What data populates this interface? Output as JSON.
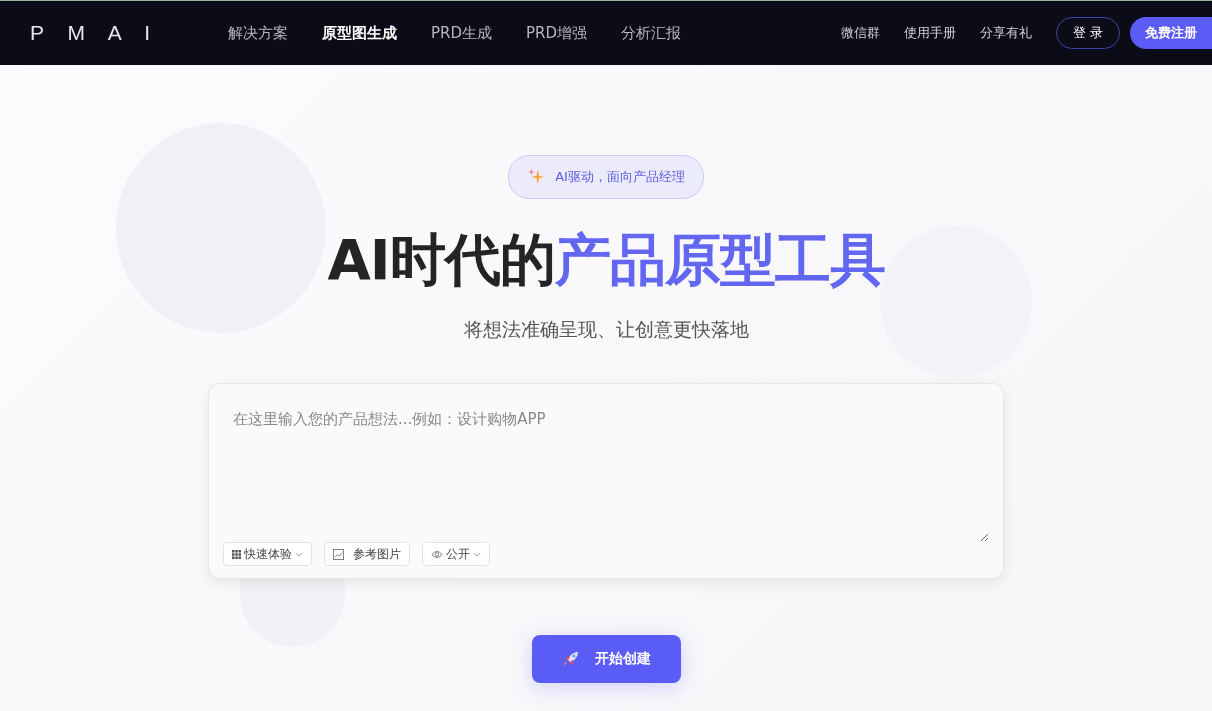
{
  "header": {
    "logo": "P M A I",
    "nav": [
      {
        "label": "解决方案",
        "selected": false
      },
      {
        "label": "原型图生成",
        "selected": true
      },
      {
        "label": "PRD生成",
        "selected": false
      },
      {
        "label": "PRD增强",
        "selected": false
      },
      {
        "label": "分析汇报",
        "selected": false
      }
    ],
    "links": [
      "微信群",
      "使用手册",
      "分享有礼"
    ],
    "login": "登 录",
    "register": "免费注册"
  },
  "hero": {
    "badge": "AI驱动，面向产品经理",
    "title_plain": "AI时代的",
    "title_accent": "产品原型工具",
    "subtitle": "将想法准确呈现、让创意更快落地"
  },
  "prompt": {
    "placeholder": "在这里输入您的产品想法...例如：设计购物APP",
    "tools": [
      {
        "kind": "template",
        "label": "快速体验"
      },
      {
        "kind": "image",
        "label": "参考图片"
      },
      {
        "kind": "visibility",
        "label": "公开"
      }
    ]
  },
  "submit": "开始创建"
}
